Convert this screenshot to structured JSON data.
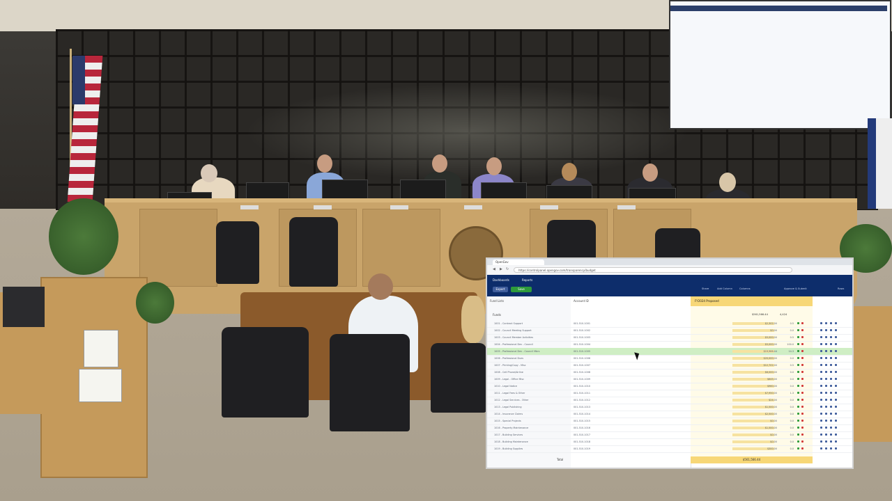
{
  "scene": {
    "description_free": true
  },
  "app": {
    "browser": {
      "tab_title": "OpenGov",
      "url": "https://controlpanel.opengov.com/transparency/budget"
    },
    "nav": {
      "primary_tab": "Dashboards",
      "secondary_tab": "Reports",
      "pill_1": "Export",
      "pill_2": "Save",
      "toolbar": [
        "Share",
        "Add Column",
        "Columns",
        "Approve & Submit",
        "Rows"
      ]
    },
    "sidebar": {
      "header": "Fund Lists",
      "group": "Funds"
    },
    "columns": {
      "account": "Account ID",
      "value": "FY2024 Proposed"
    },
    "summary_row": {
      "value": "$561,566.44",
      "delta": "4,424"
    },
    "rows": [
      {
        "name": "1001 - Contract Support",
        "id": "001-510-1001",
        "value": "$2,302.00",
        "pct": "0.5"
      },
      {
        "name": "1002 - Council Meeting Support",
        "id": "001-510-1002",
        "value": "$0.00",
        "pct": "0.0"
      },
      {
        "name": "1003 - Council Member Activities",
        "id": "001-510-1003",
        "value": "$5,000.00",
        "pct": "0.5"
      },
      {
        "name": "1004 - Professional Dev - Council",
        "id": "001-510-1004",
        "value": "$5,000.00",
        "pct": "100.0"
      },
      {
        "name": "1005 - Professional Dev - Council Mbrs",
        "id": "001-510-1005",
        "value": "$19,966.44",
        "pct": "14.3",
        "selected": true
      },
      {
        "name": "1006 - Professional Dues",
        "id": "001-510-1006",
        "value": "$20,000.00",
        "pct": "0.0"
      },
      {
        "name": "1007 - Printing/Copy - Misc",
        "id": "001-510-1007",
        "value": "$12,702.00",
        "pct": "0.5"
      },
      {
        "name": "1008 - Cell Phone/Airline",
        "id": "001-510-1008",
        "value": "$6,000.00",
        "pct": "0.0"
      },
      {
        "name": "1009 - Legal - Office Misc",
        "id": "001-510-1009",
        "value": "$645.00",
        "pct": "0.0"
      },
      {
        "name": "1010 - Legal Notice",
        "id": "001-510-1010",
        "value": "$960.00",
        "pct": "0.0"
      },
      {
        "name": "1011 - Legal Fees & Other",
        "id": "001-510-1011",
        "value": "$7,950.00",
        "pct": "1.3"
      },
      {
        "name": "1012 - Legal Services - Other",
        "id": "001-510-1012",
        "value": "$24.00",
        "pct": "0.0"
      },
      {
        "name": "1013 - Legal Publishing",
        "id": "001-510-1013",
        "value": "$1,500.00",
        "pct": "0.0"
      },
      {
        "name": "1014 - Insurance Claims",
        "id": "001-510-1014",
        "value": "$2,500.00",
        "pct": "0.0"
      },
      {
        "name": "1015 - Special Projects",
        "id": "001-510-1015",
        "value": "$0.00",
        "pct": "0.0"
      },
      {
        "name": "1016 - Property Maintenance",
        "id": "001-510-1016",
        "value": "$1,500.00",
        "pct": "0.0"
      },
      {
        "name": "1017 - Building Services",
        "id": "001-510-1017",
        "value": "$0.00",
        "pct": "0.0"
      },
      {
        "name": "1018 - Building Maintenance",
        "id": "001-510-1018",
        "value": "$0.00",
        "pct": "0.0"
      },
      {
        "name": "1019 - Building Supplies",
        "id": "001-510-1019",
        "value": "$300.00",
        "pct": "0.0"
      }
    ],
    "footer": {
      "label": "Total",
      "total": "$561,566.44"
    },
    "colors": {
      "appbar": "#0d2d6b",
      "accent": "#f7d777",
      "selected_row": "#cfeec4",
      "up": "#2e9b3b",
      "down": "#d23a3a"
    }
  }
}
